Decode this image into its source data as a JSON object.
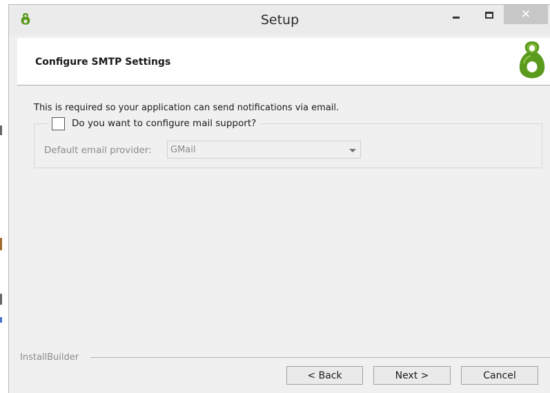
{
  "window": {
    "title": "Setup",
    "close_glyph": "✕"
  },
  "header": {
    "title": "Configure SMTP Settings",
    "logo_icon": "installbuilder-logo-icon"
  },
  "content": {
    "description": "This is required so your application can send notifications via email.",
    "mail_support": {
      "label": "Do you want to configure mail support?",
      "checked": false
    },
    "provider": {
      "label": "Default email provider:",
      "value": "GMail",
      "enabled": false
    }
  },
  "footer": {
    "brand": "InstallBuilder",
    "back_label": "< Back",
    "next_label": "Next >",
    "cancel_label": "Cancel"
  },
  "colors": {
    "logo_green": "#5a9a1c",
    "window_bg": "#f0f0f0",
    "header_bg": "#ffffff"
  }
}
